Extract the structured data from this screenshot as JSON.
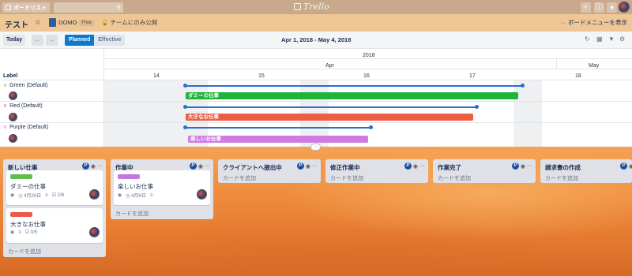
{
  "topbar": {
    "boards_label": "ボードリスト",
    "logo_text": "Trello"
  },
  "header": {
    "board_title": "テスト",
    "team_name": "DOMO",
    "team_badge": "Free",
    "visibility": "チームにのみ公開",
    "menu_link": "ボードメニューを表示"
  },
  "timeline": {
    "today_label": "Today",
    "mode_planned": "Planned",
    "mode_effective": "Effective",
    "date_range": "Apr 1, 2018 - May 4, 2018",
    "year": "2018",
    "months": [
      "Apr",
      "May"
    ],
    "days": [
      "14",
      "15",
      "16",
      "17",
      "18"
    ],
    "label_header": "Label",
    "rows": [
      {
        "label": "Green (Default)",
        "color": "#61bd4f",
        "bar_text": "ダミーの仕事",
        "bar_color": "#1fb33a"
      },
      {
        "label": "Red (Default)",
        "color": "#eb5a46",
        "bar_text": "大きなお仕事",
        "bar_color": "#ef5d43"
      },
      {
        "label": "Purple (Default)",
        "color": "#c377e0",
        "bar_text": "楽しいお仕事",
        "bar_color": "#d07be0"
      }
    ]
  },
  "lists": [
    {
      "title": "新しい仕事",
      "add_card": "カードを追加",
      "cards": [
        {
          "title": "ダミーの仕事",
          "label_color": "#61bd4f",
          "due": "4月26日",
          "checklist": "2/6"
        },
        {
          "title": "大きなお仕事",
          "label_color": "#eb5a46",
          "due": "",
          "checklist": "0/5"
        }
      ]
    },
    {
      "title": "作業中",
      "add_card": "カードを追加",
      "cards": [
        {
          "title": "楽しいお仕事",
          "label_color": "#c377e0",
          "due": "4月8日",
          "checklist": ""
        }
      ]
    },
    {
      "title": "クライアントへ提出中",
      "add_card": "カードを追加",
      "cards": []
    },
    {
      "title": "修正作業中",
      "add_card": "カードを追加",
      "cards": []
    },
    {
      "title": "作業完了",
      "add_card": "カードを追加",
      "cards": []
    },
    {
      "title": "請求書の作成",
      "add_card": "カードを追加",
      "cards": []
    }
  ]
}
